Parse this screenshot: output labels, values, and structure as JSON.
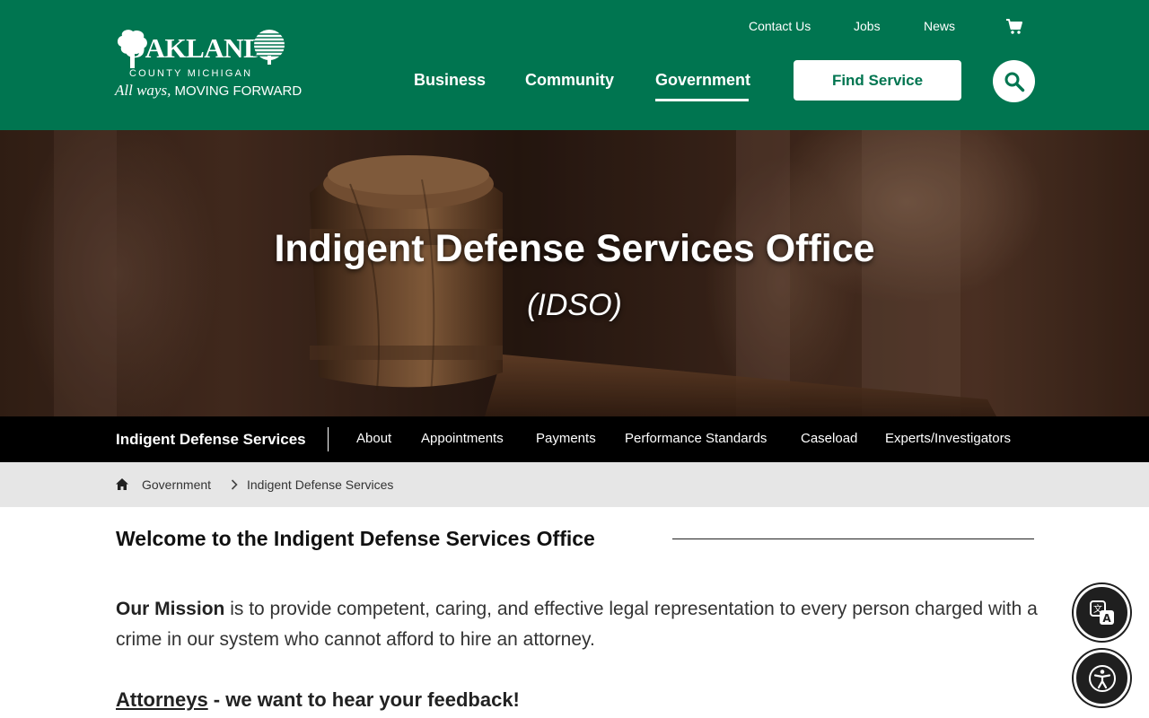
{
  "header": {
    "logo": {
      "wordmark": "OAKLAND",
      "county": "COUNTY MICHIGAN",
      "tagline_script": "All ways,",
      "tagline": "MOVING FORWARD"
    },
    "utility_links": [
      "Contact Us",
      "Jobs",
      "News"
    ],
    "cart_icon": "shopping-cart-icon",
    "nav": [
      "Business",
      "Community",
      "Government"
    ],
    "active_nav": "Government",
    "find_service_label": "Find Service",
    "search_icon": "search-icon"
  },
  "hero": {
    "title": "Indigent Defense Services Office",
    "subtitle": "(IDSO)"
  },
  "subnav": {
    "title": "Indigent Defense Services",
    "links": [
      "About",
      "Appointments",
      "Payments",
      "Performance Standards",
      "Caseload",
      "Experts/Investigators"
    ]
  },
  "breadcrumb": {
    "home_icon": "home-icon",
    "items": [
      "Government",
      "Indigent Defense Services"
    ]
  },
  "content": {
    "heading": "Welcome to the Indigent Defense Services Office",
    "mission_lead": "Our Mission",
    "mission_text": " is to provide competent, caring, and effective legal representation to every person charged with a crime in our system who cannot afford to hire an attorney.",
    "feedback_link": "Attorneys",
    "feedback_text": " - we want to hear your feedback!"
  },
  "floating": {
    "translate_icon": "translate-icon",
    "accessibility_icon": "accessibility-icon"
  },
  "colors": {
    "brand_green": "#007550",
    "subnav_bg": "#000000",
    "breadcrumb_bg": "#e6e6e6",
    "fab_bg": "#1f1f1f"
  }
}
